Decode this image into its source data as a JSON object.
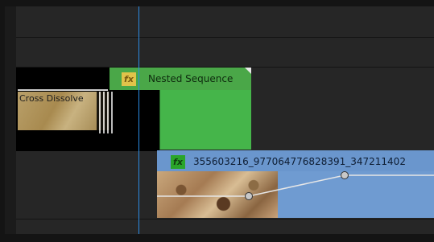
{
  "timeline": {
    "nested_clip": {
      "fx_label": "fx",
      "name": "Nested Sequence",
      "color": "#4aa748"
    },
    "transition": {
      "name": "Cross Dissolve",
      "color": "#b9a06a"
    },
    "video_clip": {
      "fx_label": "fx",
      "name": "355603216_977064776828391_347211402",
      "color": "#6f9bd1"
    },
    "playhead_color": "#2b8be3"
  }
}
